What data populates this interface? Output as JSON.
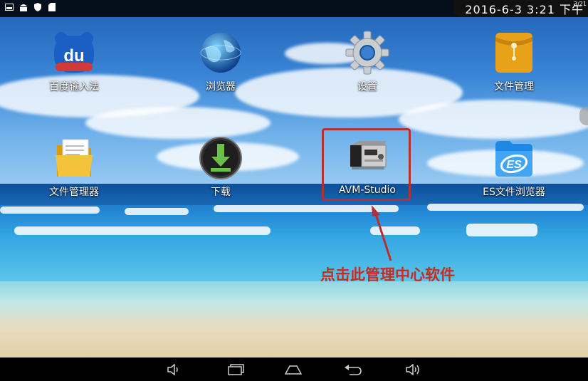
{
  "status_bar": {
    "clock": "2016-6-3  3:21 下午",
    "signal": "3/21",
    "icons": [
      "screenshot-icon",
      "android-icon",
      "shield-icon",
      "sdcard-icon",
      "wifi-icon"
    ]
  },
  "apps": [
    {
      "label": "百度输入法",
      "icon": "baidu-input-icon"
    },
    {
      "label": "浏览器",
      "icon": "globe-icon"
    },
    {
      "label": "设置",
      "icon": "gear-icon"
    },
    {
      "label": "文件管理",
      "icon": "folder-clip-icon"
    },
    {
      "label": "文件管理器",
      "icon": "file-manager-icon"
    },
    {
      "label": "下载",
      "icon": "download-icon"
    },
    {
      "label": "AVM-Studio",
      "icon": "avm-device-icon"
    },
    {
      "label": "ES文件浏览器",
      "icon": "es-explorer-icon"
    }
  ],
  "annotation": "点击此管理中心软件",
  "nav_bar": [
    "volume-down-icon",
    "recent-apps-icon",
    "home-icon",
    "back-icon",
    "volume-up-icon"
  ],
  "colors": {
    "annotation": "#c62b24",
    "status_bar": "#000000"
  }
}
